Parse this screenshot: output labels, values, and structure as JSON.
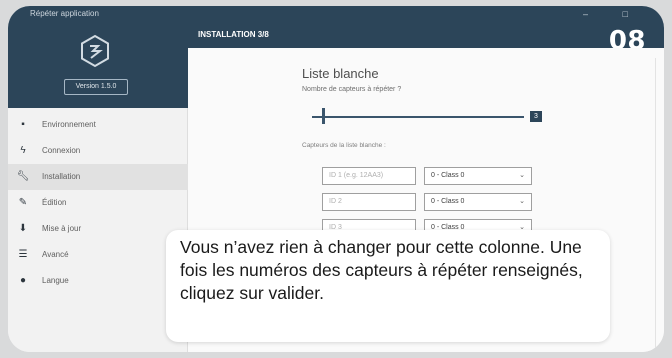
{
  "window": {
    "title": "Répéter application",
    "controls": "– □"
  },
  "sidebar": {
    "version_label": "Version 1.5.0",
    "items": [
      {
        "label": "Environnement",
        "icon": "monitor-icon"
      },
      {
        "label": "Connexion",
        "icon": "lightning-icon"
      },
      {
        "label": "Installation",
        "icon": "wrench-icon"
      },
      {
        "label": "Édition",
        "icon": "edit-icon"
      },
      {
        "label": "Mise à jour",
        "icon": "download-icon"
      },
      {
        "label": "Avancé",
        "icon": "sliders-icon"
      },
      {
        "label": "Langue",
        "icon": "globe-icon"
      }
    ],
    "active_index": 2
  },
  "header": {
    "step_title": "INSTALLATION 3/8",
    "badge": "08"
  },
  "main": {
    "title": "Liste blanche",
    "sensor_count_label": "Nombre de capteurs à répéter ?",
    "slider_value": "3",
    "list_label": "Capteurs de la liste blanche :",
    "rows": [
      {
        "id_placeholder": "ID 1 (e.g. 12AA3)",
        "class_value": "0 - Class 0"
      },
      {
        "id_placeholder": "ID 2",
        "class_value": "0 - Class 0"
      },
      {
        "id_placeholder": "ID 3",
        "class_value": "0 - Class 0"
      }
    ]
  },
  "caption": {
    "text": "Vous n’avez rien à changer pour cette colonne. Une fois les numéros des capteurs à répéter renseignés, cliquez sur valider."
  },
  "colors": {
    "brand_dark": "#1d3a52",
    "accent": "#2b4b66"
  }
}
